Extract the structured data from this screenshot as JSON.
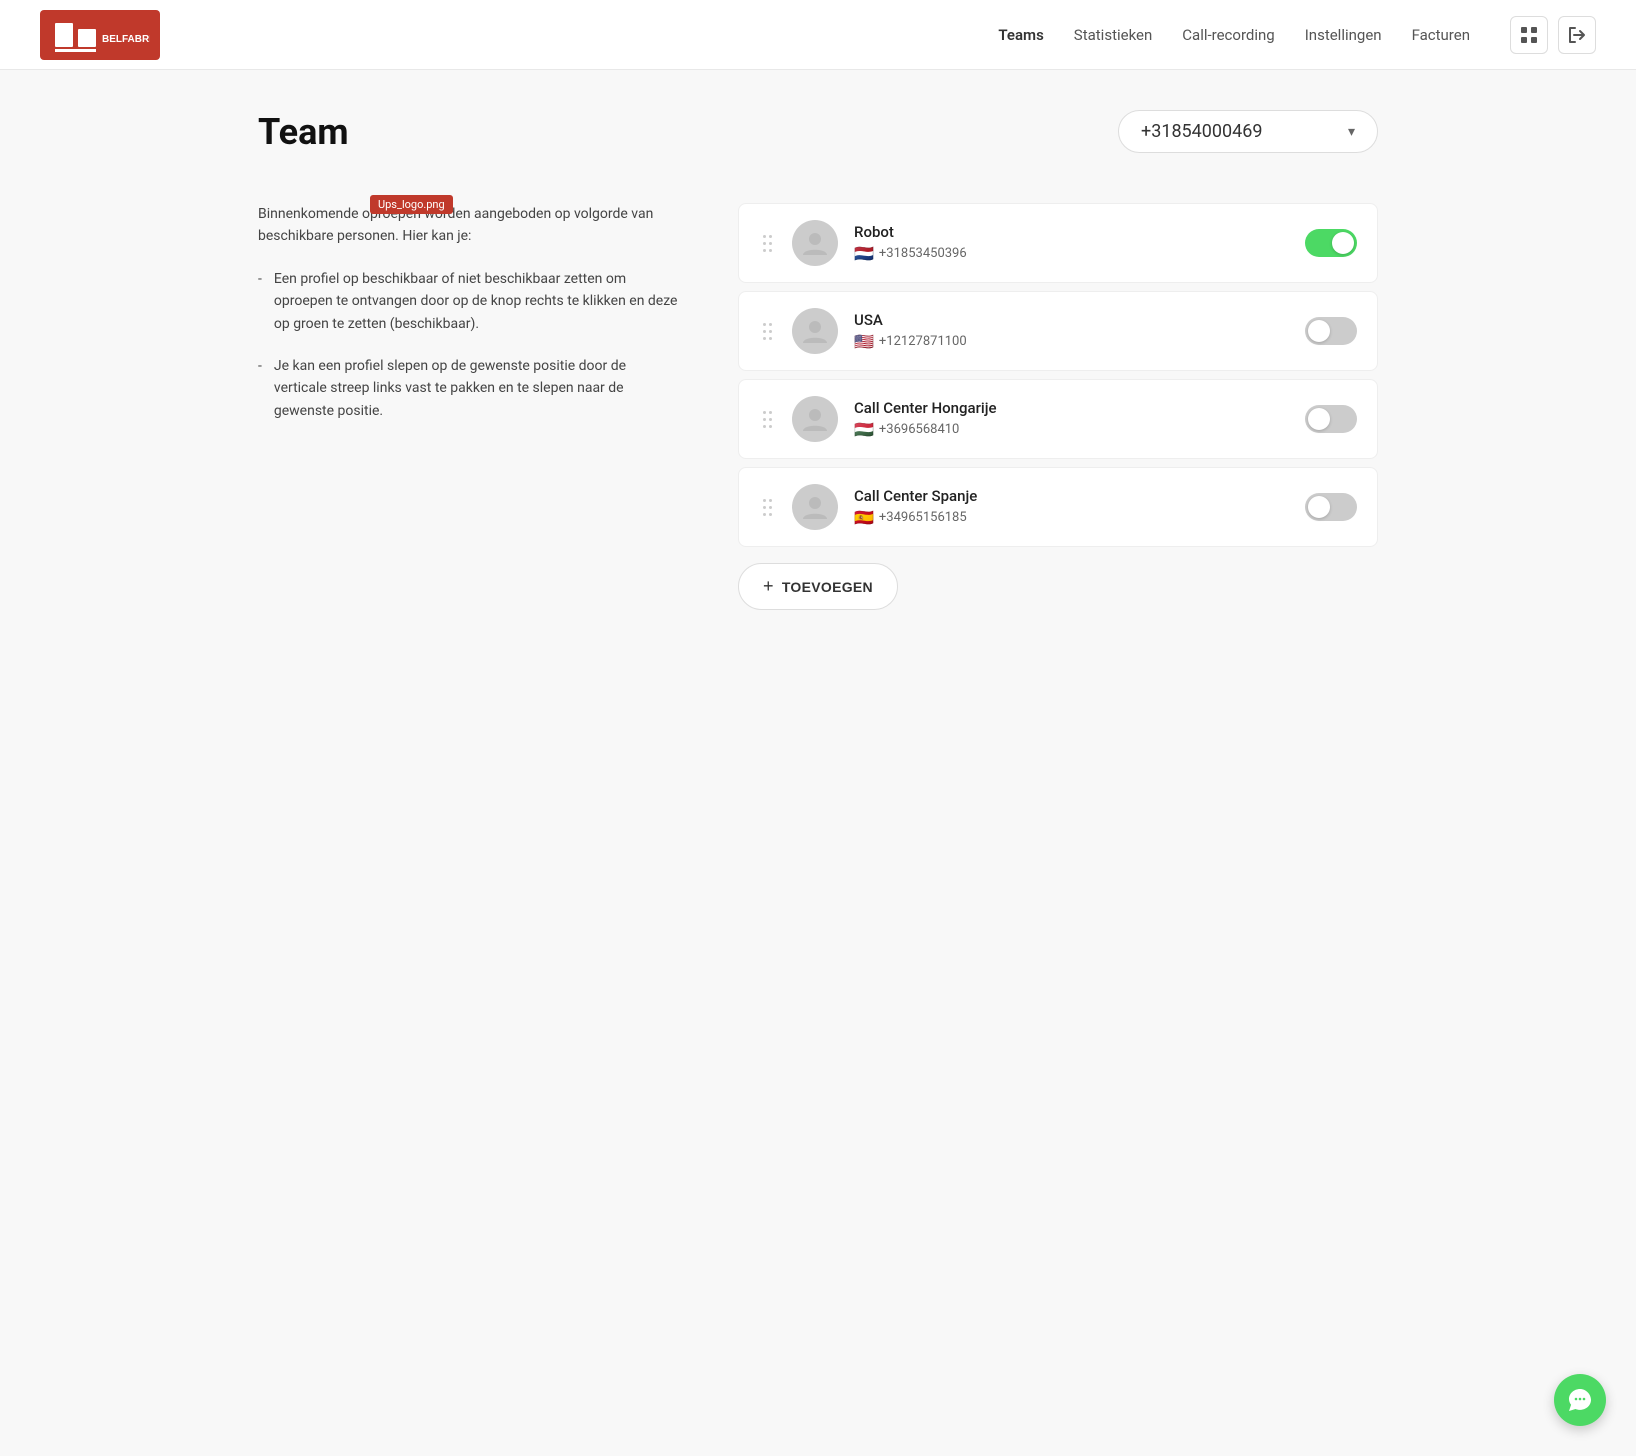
{
  "header": {
    "logo_alt": "Belfabriek",
    "nav": [
      {
        "id": "teams",
        "label": "Teams",
        "active": true
      },
      {
        "id": "statistieken",
        "label": "Statistieken",
        "active": false
      },
      {
        "id": "call-recording",
        "label": "Call-recording",
        "active": false
      },
      {
        "id": "instellingen",
        "label": "Instellingen",
        "active": false
      },
      {
        "id": "facturen",
        "label": "Facturen",
        "active": false
      }
    ],
    "icon_grid": "⊞",
    "icon_exit": "→"
  },
  "page": {
    "title": "Team",
    "phone_number": "+31854000469"
  },
  "intro": {
    "paragraph": "Binnenkomende oproepen worden aangeboden op volgorde van beschikbare personen. Hier kan je:",
    "bullets": [
      "Een profiel op beschikbaar of niet beschikbaar zetten om oproepen te ontvangen door op de knop rechts te klikken en deze op groen te zetten (beschikbaar).",
      "Je kan een profiel slepen op de gewenste positie door de verticale streep links vast te pakken en te slepen naar de gewenste positie."
    ]
  },
  "members": [
    {
      "id": 1,
      "name": "Robot",
      "phone": "+31853450396",
      "flag": "🇳🇱",
      "active": true
    },
    {
      "id": 2,
      "name": "USA",
      "phone": "+12127871100",
      "flag": "🇺🇸",
      "active": false
    },
    {
      "id": 3,
      "name": "Call Center Hongarije",
      "phone": "+3696568410",
      "flag": "🇭🇺",
      "active": false
    },
    {
      "id": 4,
      "name": "Call Center Spanje",
      "phone": "+34965156185",
      "flag": "🇪🇸",
      "active": false
    }
  ],
  "add_button_label": "+ TOEVOEGEN",
  "ups_tooltip": "Ups_logo.png",
  "chat_icon": "💬"
}
